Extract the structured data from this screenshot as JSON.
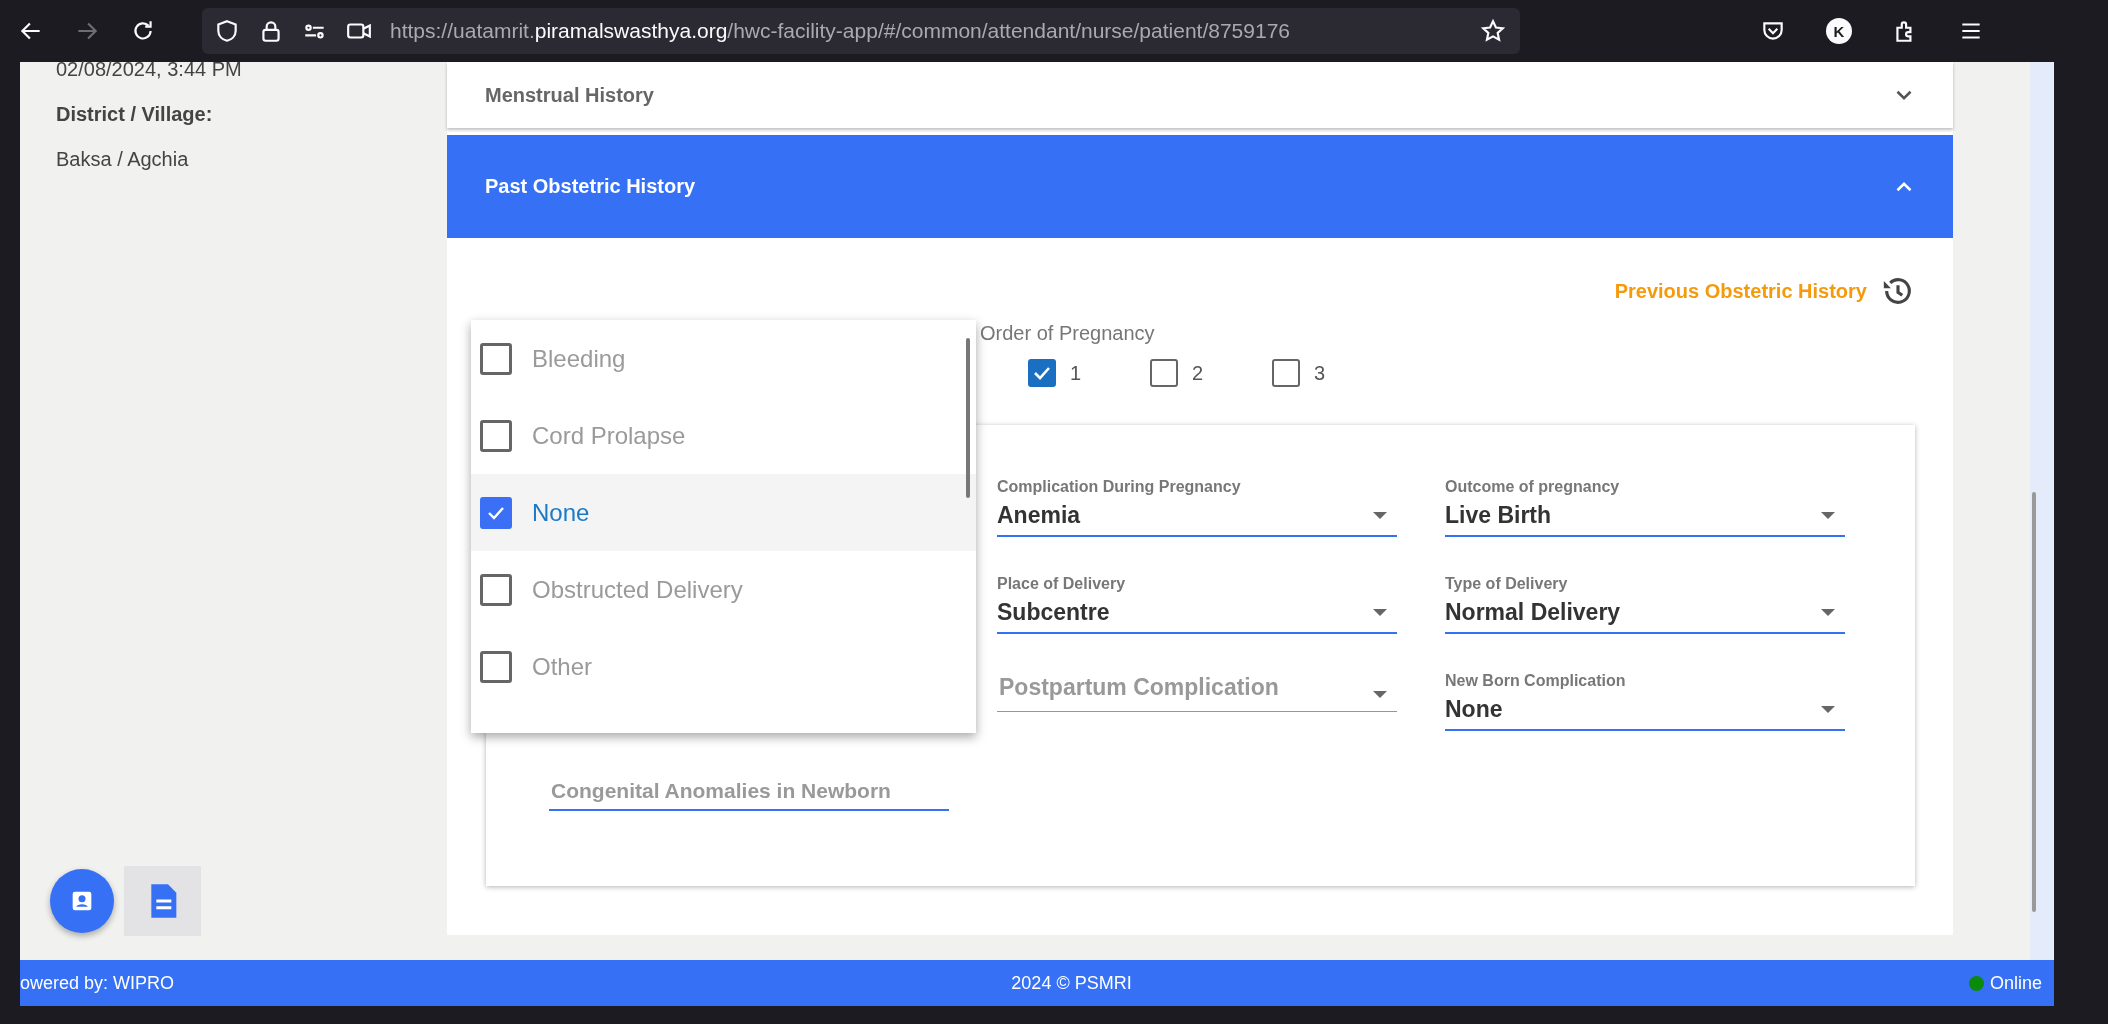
{
  "browser": {
    "url_prefix": "https://uatamrit.",
    "url_host": "piramalswasthya.org",
    "url_path": "/hwc-facility-app/#/common/attendant/nurse/patient/8759176",
    "profile_initial": "K",
    "forward_enabled": false
  },
  "sidebar": {
    "visit_time": "02/08/2024, 3:44 PM",
    "location_label": "District / Village:",
    "location_value": "Baksa / Agchia"
  },
  "sections": [
    {
      "title": "Menstrual History",
      "expanded": false
    },
    {
      "title": "Past Obstetric History",
      "expanded": true
    }
  ],
  "previous_history_link": "Previous Obstetric History",
  "order_of_pregnancy": {
    "label": "Order of Pregnancy",
    "options": [
      {
        "label": "1",
        "checked": true
      },
      {
        "label": "2",
        "checked": false
      },
      {
        "label": "3",
        "checked": false
      }
    ]
  },
  "form_columns": [
    {
      "fields": [
        {
          "kind": "text-empty",
          "placeholder": "Congenital Anomalies in Newborn"
        }
      ]
    },
    {
      "fields": [
        {
          "kind": "select",
          "label": "Complication During Pregnancy",
          "value": "Anemia"
        },
        {
          "kind": "select",
          "label": "Place of Delivery",
          "value": "Subcentre"
        },
        {
          "kind": "select-empty",
          "placeholder": "Postpartum Complication"
        }
      ]
    },
    {
      "fields": [
        {
          "kind": "select",
          "label": "Outcome of pregnancy",
          "value": "Live Birth"
        },
        {
          "kind": "select",
          "label": "Type of Delivery",
          "value": "Normal Delivery"
        },
        {
          "kind": "select",
          "label": "New Born Complication",
          "value": "None"
        }
      ]
    }
  ],
  "menu": {
    "options": [
      {
        "label": "Bleeding",
        "checked": false
      },
      {
        "label": "Cord Prolapse",
        "checked": false
      },
      {
        "label": "None",
        "checked": true
      },
      {
        "label": "Obstructed Delivery",
        "checked": false
      },
      {
        "label": "Other",
        "checked": false
      }
    ]
  },
  "footer": {
    "left": "owered by: WIPRO",
    "center": "2024 © PSMRI",
    "status": {
      "label": "Online",
      "online": true
    }
  }
}
